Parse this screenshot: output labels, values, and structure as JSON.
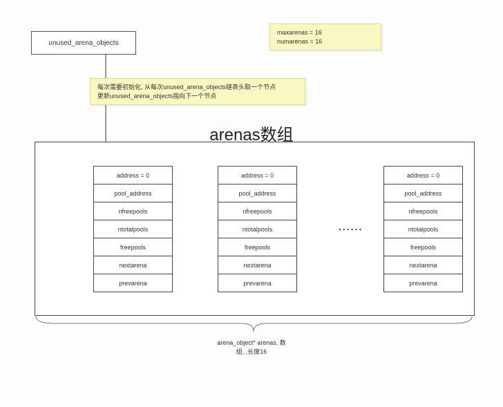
{
  "top_box_label": "unused_arena_objects",
  "note_vars": {
    "line1": "maxarenas = 16",
    "line2": "numarenas = 16"
  },
  "note_desc": {
    "line1": "每次需要初始化, 从每次unused_arena_objects链表头取一个节点",
    "line2": "更新unused_arena_objects指向下一个节点"
  },
  "title": "arenas数组",
  "struct_rows": [
    "address = 0",
    "pool_address",
    "nfreepools",
    "ntotalpools",
    "freepools",
    "nextarena",
    "prevarena"
  ],
  "dots": "......",
  "bottom_caption": {
    "line1": "arena_object* arenas,   数",
    "line2": "组, ,长度16"
  }
}
